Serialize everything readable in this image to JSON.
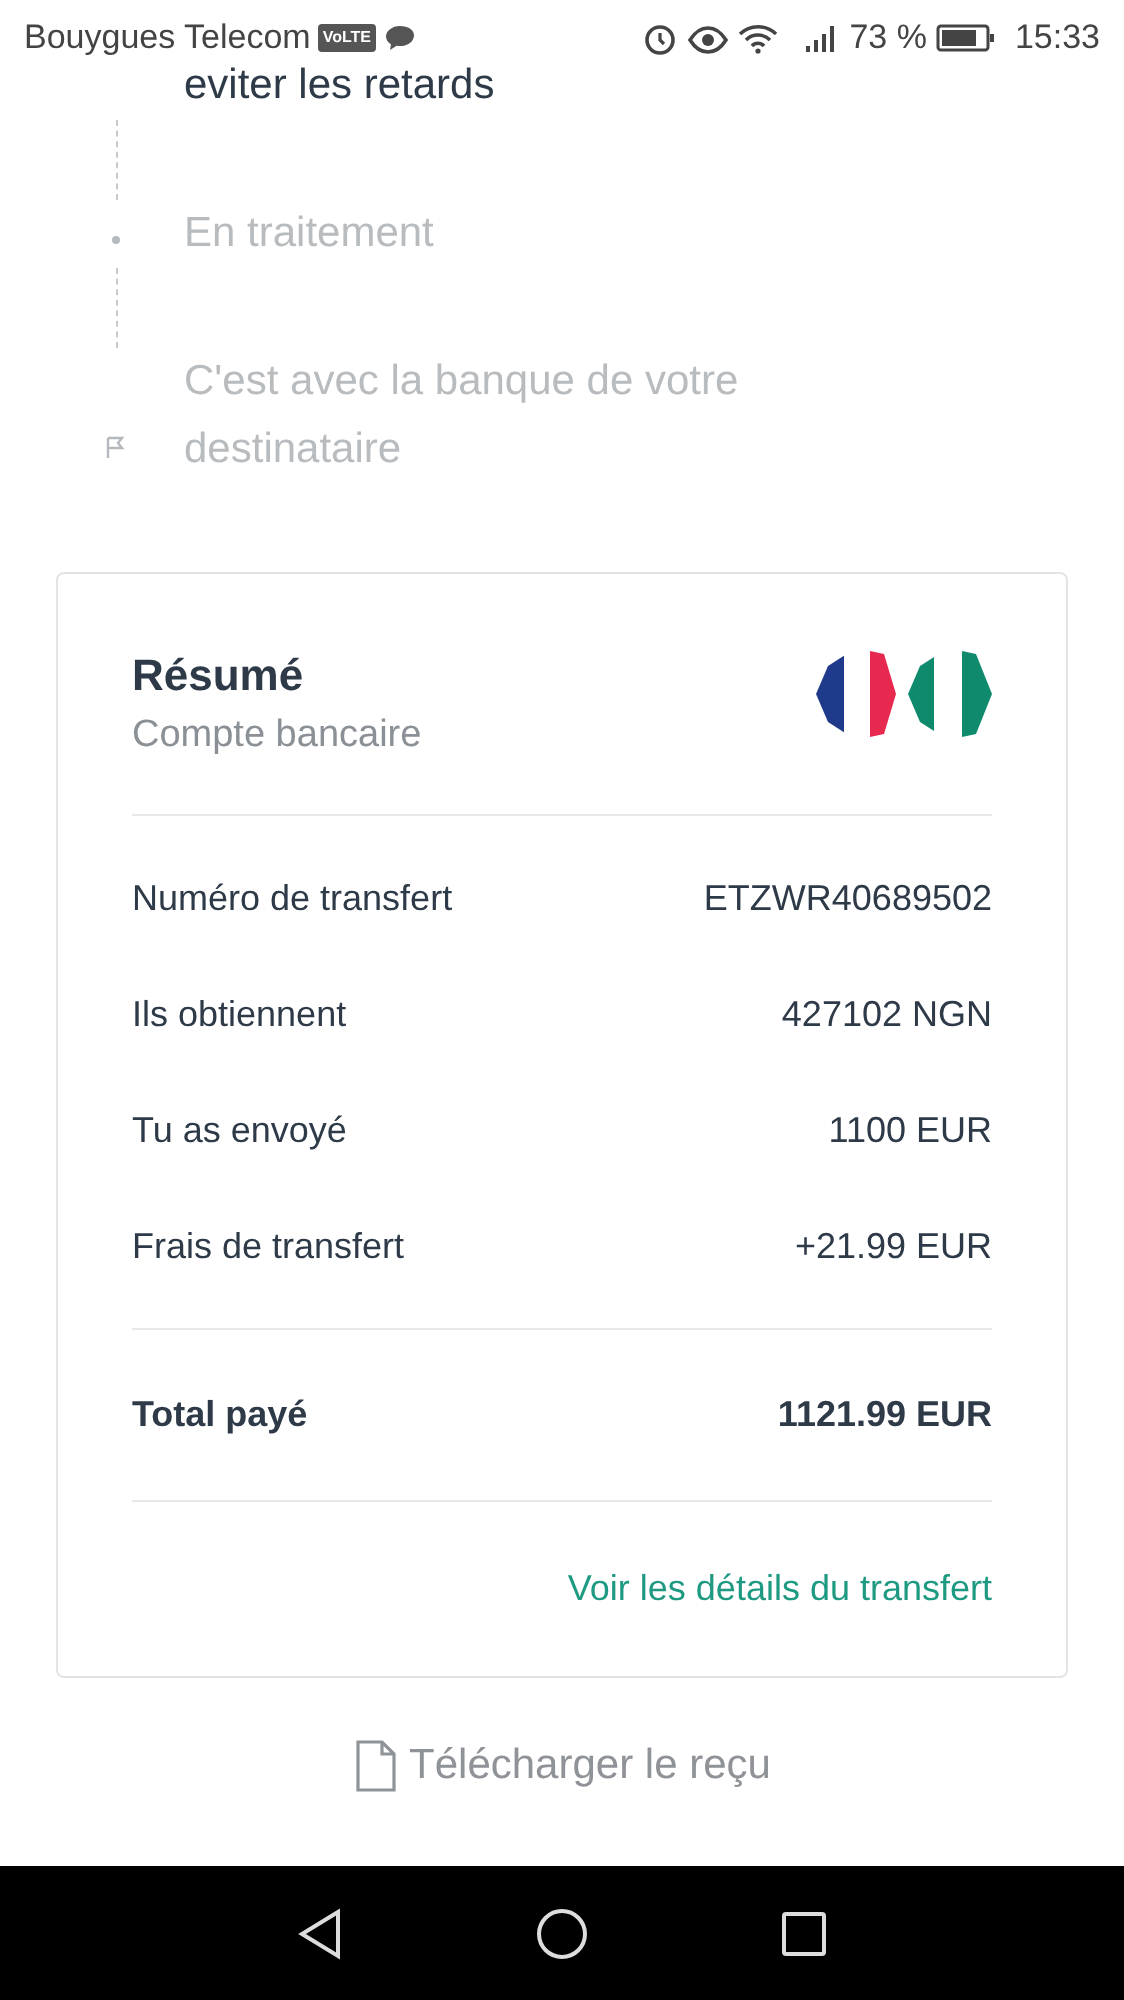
{
  "status_bar": {
    "carrier": "Bouygues Telecom",
    "volte": "VoLTE",
    "battery_text": "73 %",
    "time": "15:33"
  },
  "timeline": [
    {
      "text": "eviter les retards",
      "active": true,
      "kind": "plain"
    },
    {
      "text": "En traitement",
      "active": false,
      "kind": "dot"
    },
    {
      "text": "C'est avec la banque de votre destinataire",
      "active": false,
      "kind": "flag"
    }
  ],
  "summary": {
    "title": "Résumé",
    "subtitle": "Compte bancaire",
    "rows": [
      {
        "label": "Numéro de transfert",
        "value": "ETZWR40689502"
      },
      {
        "label": "Ils obtiennent",
        "value": "427102 NGN"
      },
      {
        "label": "Tu as envoyé",
        "value": "1100 EUR"
      },
      {
        "label": "Frais de transfert",
        "value": "+21.99 EUR"
      }
    ],
    "total": {
      "label": "Total payé",
      "value": "1121.99 EUR"
    },
    "details_link": "Voir les détails du transfert"
  },
  "download_link": "Télécharger le reçu"
}
